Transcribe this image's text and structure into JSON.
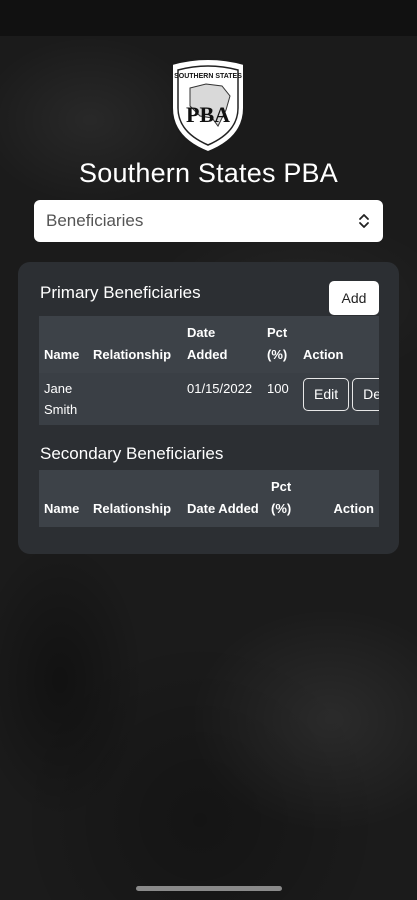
{
  "app": {
    "title": "Southern States PBA",
    "logo_text": "SOUTHERN STATES",
    "logo_monogram": "PBA"
  },
  "selector": {
    "selected": "Beneficiaries",
    "icon": "chevron-up-down-icon"
  },
  "primary": {
    "title": "Primary Beneficiaries",
    "add_label": "Add",
    "headers": {
      "name": "Name",
      "relationship": "Relationship",
      "date_added": "Date Added",
      "pct": "Pct (%)",
      "action": "Action"
    },
    "rows": [
      {
        "name": "Jane Smith",
        "relationship": "",
        "date_added": "01/15/2022",
        "pct": "100",
        "edit_label": "Edit",
        "delete_label": "Delete"
      }
    ]
  },
  "secondary": {
    "title": "Secondary Beneficiaries",
    "headers": {
      "name": "Name",
      "relationship": "Relationship",
      "date_added": "Date Added",
      "pct": "Pct (%)",
      "action": "Action"
    }
  },
  "colors": {
    "card_bg": "#2c2f33",
    "table_header_bg": "#3d4248",
    "table_row_bg": "#3a3f45",
    "background": "#1b1b1b"
  }
}
